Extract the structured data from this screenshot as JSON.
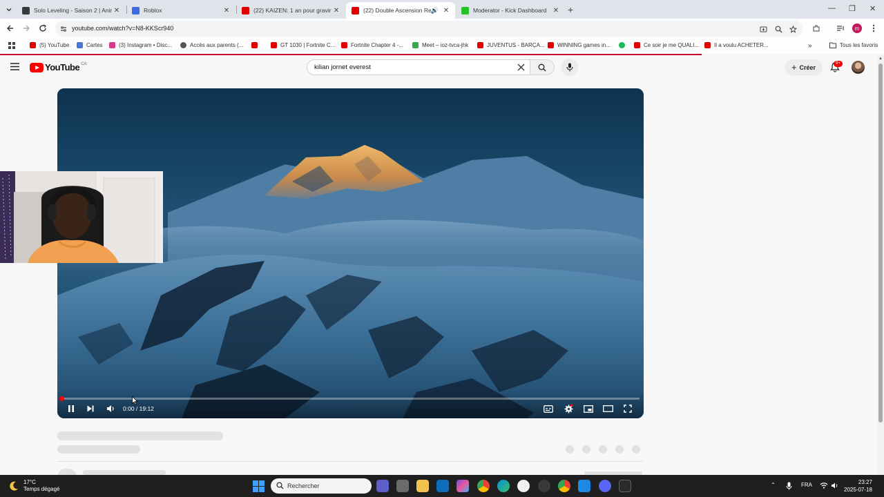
{
  "browser": {
    "tabs": [
      {
        "title": "Solo Leveling - Saison 2 | Anim",
        "favicon": "crunchyroll-favicon",
        "color": "#3a3a3a",
        "active": false
      },
      {
        "title": "Roblox",
        "favicon": "roblox-favicon",
        "color": "#3c6ae0",
        "active": false
      },
      {
        "title": "(22) KAIZEN: 1 an pour gravir l'",
        "favicon": "youtube-favicon",
        "color": "#e00000",
        "active": false
      },
      {
        "title": "(22) Double Ascension Reco",
        "favicon": "youtube-favicon",
        "color": "#e00000",
        "active": true
      },
      {
        "title": "Moderator - Kick Dashboard",
        "favicon": "kick-favicon",
        "color": "#27c227",
        "active": false
      }
    ],
    "url": "youtube.com/watch?v=N8-KKScr940",
    "bookmarks": [
      {
        "label": "(5) YouTube",
        "color": "#e00000"
      },
      {
        "label": "Cartes",
        "color": "#4a74d6"
      },
      {
        "label": "(3) Instagram • Disc...",
        "color": "#d9388a"
      },
      {
        "label": "Accès aux parents (...",
        "color": "#555555"
      },
      {
        "label": "",
        "color": "#e00000"
      },
      {
        "label": "GT 1030 | Fortnite C...",
        "color": "#e00000"
      },
      {
        "label": "Fortnite Chapter 4 -...",
        "color": "#e00000"
      },
      {
        "label": "Meet – ioz-tvca-jhk",
        "color": "#34a853"
      },
      {
        "label": "JUVENTUS - BARÇA...",
        "color": "#e00000"
      },
      {
        "label": "WINNING games in...",
        "color": "#e00000"
      },
      {
        "label": "",
        "color": "#1db954"
      },
      {
        "label": "Ce soir je me QUALI...",
        "color": "#e00000"
      },
      {
        "label": "Il a voulu ACHETER...",
        "color": "#e00000"
      }
    ],
    "all_bookmarks": "Tous les favoris",
    "profile_initial": "m"
  },
  "youtube": {
    "logo_text": "YouTube",
    "country": "CA",
    "search_query": "kilian jornet everest",
    "create_label": "Créer",
    "notifications_badge": "9+"
  },
  "player": {
    "time": "0:00 / 19:12",
    "progress": 0.005
  },
  "taskbar": {
    "temperature": "17°C",
    "weather": "Temps dégagé",
    "search_placeholder": "Rechercher",
    "language": "FRA",
    "time": "23:27",
    "date": "2025-07-18"
  }
}
